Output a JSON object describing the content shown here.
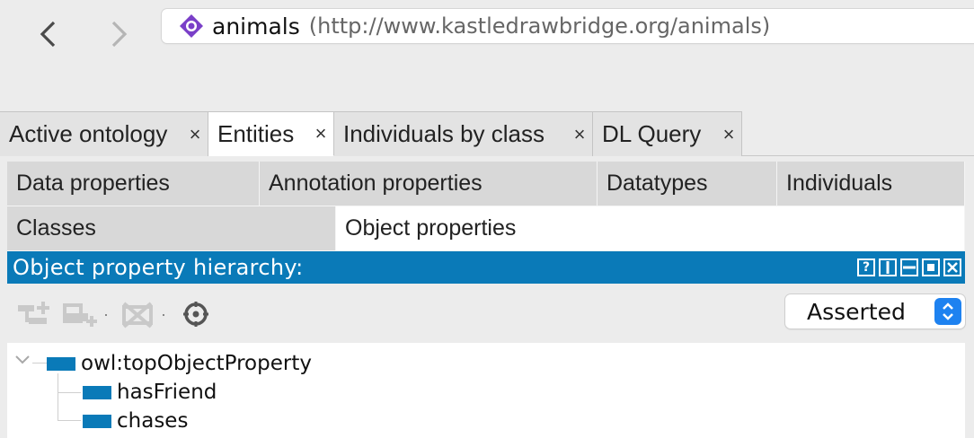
{
  "nav": {
    "back_icon": "chevron-left-icon",
    "forward_icon": "chevron-right-icon"
  },
  "url_bar": {
    "icon": "ontology-diamond-icon",
    "ontology_name": "animals",
    "iri": "(http://www.kastledrawbridge.org/animals)"
  },
  "tabs": [
    {
      "label": "Active ontology",
      "close": "×",
      "active": false
    },
    {
      "label": "Entities",
      "close": "×",
      "active": true
    },
    {
      "label": "Individuals by class",
      "close": "×",
      "active": false
    },
    {
      "label": "DL Query",
      "close": "×",
      "active": false
    }
  ],
  "entity_tabs": {
    "row1": [
      {
        "label": "Data properties"
      },
      {
        "label": "Annotation properties"
      },
      {
        "label": "Datatypes"
      },
      {
        "label": "Individuals"
      }
    ],
    "row2": [
      {
        "label": "Classes",
        "active": false
      },
      {
        "label": "Object properties",
        "active": true
      }
    ]
  },
  "view": {
    "title": "Object property hierarchy:",
    "buttons": [
      "help-icon",
      "split-vertical-icon",
      "split-horizontal-icon",
      "maximize-icon",
      "close-icon"
    ],
    "help_glyph": "?"
  },
  "toolbar": {
    "tools": [
      "add-subproperty-icon",
      "add-sibling-property-icon",
      "delete-property-icon",
      "find-usage-icon"
    ],
    "mode_select": {
      "value": "Asserted"
    }
  },
  "tree": {
    "root": "owl:topObjectProperty",
    "children": [
      "hasFriend",
      "chases"
    ]
  },
  "colors": {
    "accent": "#0a7ab8",
    "select_accent": "#1e82f0",
    "ontology_icon": "#7a3fc8"
  }
}
